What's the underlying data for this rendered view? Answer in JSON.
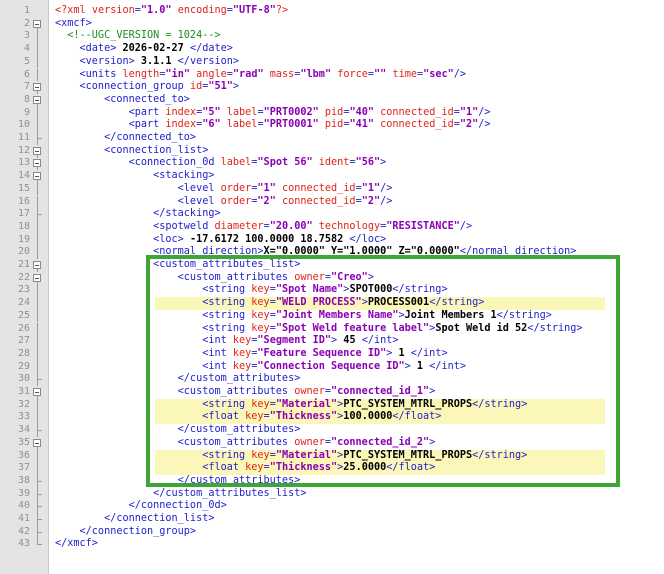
{
  "editor": {
    "accent_color": "#3fa535",
    "highlight_color": "#fbf7b8",
    "lines": [
      {
        "n": "1",
        "seg": [
          {
            "c": "pi",
            "t": "<?xml "
          },
          {
            "c": "attr",
            "t": "version"
          },
          {
            "c": "tag",
            "t": "="
          },
          {
            "c": "val",
            "t": "\"1.0\""
          },
          {
            "c": "attr",
            "t": " encoding"
          },
          {
            "c": "tag",
            "t": "="
          },
          {
            "c": "val",
            "t": "\"UTF-8\""
          },
          {
            "c": "pi",
            "t": "?>"
          }
        ]
      },
      {
        "n": "2",
        "seg": [
          {
            "c": "tag",
            "t": "<xmcf>"
          }
        ]
      },
      {
        "n": "3",
        "seg": [
          {
            "c": "com",
            "t": "  <!--UGC_VERSION = 1024-->"
          }
        ]
      },
      {
        "n": "4",
        "seg": [
          {
            "c": "tag",
            "t": "    <date>"
          },
          {
            "c": "txt",
            "t": " 2026-02-27 "
          },
          {
            "c": "tag",
            "t": "</date>"
          }
        ]
      },
      {
        "n": "5",
        "seg": [
          {
            "c": "tag",
            "t": "    <version>"
          },
          {
            "c": "txt",
            "t": " 3.1.1 "
          },
          {
            "c": "tag",
            "t": "</version>"
          }
        ]
      },
      {
        "n": "6",
        "seg": [
          {
            "c": "tag",
            "t": "    <units "
          },
          {
            "c": "attr",
            "t": "length"
          },
          {
            "c": "tag",
            "t": "="
          },
          {
            "c": "val",
            "t": "\"in\""
          },
          {
            "c": "attr",
            "t": " angle"
          },
          {
            "c": "tag",
            "t": "="
          },
          {
            "c": "val",
            "t": "\"rad\""
          },
          {
            "c": "attr",
            "t": " mass"
          },
          {
            "c": "tag",
            "t": "="
          },
          {
            "c": "val",
            "t": "\"lbm\""
          },
          {
            "c": "attr",
            "t": " force"
          },
          {
            "c": "tag",
            "t": "="
          },
          {
            "c": "val",
            "t": "\"\""
          },
          {
            "c": "attr",
            "t": " time"
          },
          {
            "c": "tag",
            "t": "="
          },
          {
            "c": "val",
            "t": "\"sec\""
          },
          {
            "c": "tag",
            "t": "/>"
          }
        ]
      },
      {
        "n": "7",
        "seg": [
          {
            "c": "tag",
            "t": "    <connection_group "
          },
          {
            "c": "attr",
            "t": "id"
          },
          {
            "c": "tag",
            "t": "="
          },
          {
            "c": "val",
            "t": "\"51\""
          },
          {
            "c": "tag",
            "t": ">"
          }
        ]
      },
      {
        "n": "8",
        "seg": [
          {
            "c": "tag",
            "t": "        <connected_to>"
          }
        ]
      },
      {
        "n": "9",
        "seg": [
          {
            "c": "tag",
            "t": "            <part "
          },
          {
            "c": "attr",
            "t": "index"
          },
          {
            "c": "tag",
            "t": "="
          },
          {
            "c": "val",
            "t": "\"5\""
          },
          {
            "c": "attr",
            "t": " label"
          },
          {
            "c": "tag",
            "t": "="
          },
          {
            "c": "val",
            "t": "\"PRT0002\""
          },
          {
            "c": "attr",
            "t": " pid"
          },
          {
            "c": "tag",
            "t": "="
          },
          {
            "c": "val",
            "t": "\"40\""
          },
          {
            "c": "attr",
            "t": " connected_id"
          },
          {
            "c": "tag",
            "t": "="
          },
          {
            "c": "val",
            "t": "\"1\""
          },
          {
            "c": "tag",
            "t": "/>"
          }
        ]
      },
      {
        "n": "10",
        "seg": [
          {
            "c": "tag",
            "t": "            <part "
          },
          {
            "c": "attr",
            "t": "index"
          },
          {
            "c": "tag",
            "t": "="
          },
          {
            "c": "val",
            "t": "\"6\""
          },
          {
            "c": "attr",
            "t": " label"
          },
          {
            "c": "tag",
            "t": "="
          },
          {
            "c": "val",
            "t": "\"PRT0001\""
          },
          {
            "c": "attr",
            "t": " pid"
          },
          {
            "c": "tag",
            "t": "="
          },
          {
            "c": "val",
            "t": "\"41\""
          },
          {
            "c": "attr",
            "t": " connected_id"
          },
          {
            "c": "tag",
            "t": "="
          },
          {
            "c": "val",
            "t": "\"2\""
          },
          {
            "c": "tag",
            "t": "/>"
          }
        ]
      },
      {
        "n": "11",
        "seg": [
          {
            "c": "tag",
            "t": "        </connected_to>"
          }
        ]
      },
      {
        "n": "12",
        "seg": [
          {
            "c": "tag",
            "t": "        <connection_list>"
          }
        ]
      },
      {
        "n": "13",
        "seg": [
          {
            "c": "tag",
            "t": "            <connection_0d "
          },
          {
            "c": "attr",
            "t": "label"
          },
          {
            "c": "tag",
            "t": "="
          },
          {
            "c": "val",
            "t": "\"Spot 56\""
          },
          {
            "c": "attr",
            "t": " ident"
          },
          {
            "c": "tag",
            "t": "="
          },
          {
            "c": "val",
            "t": "\"56\""
          },
          {
            "c": "tag",
            "t": ">"
          }
        ]
      },
      {
        "n": "14",
        "seg": [
          {
            "c": "tag",
            "t": "                <stacking>"
          }
        ]
      },
      {
        "n": "15",
        "seg": [
          {
            "c": "tag",
            "t": "                    <level "
          },
          {
            "c": "attr",
            "t": "order"
          },
          {
            "c": "tag",
            "t": "="
          },
          {
            "c": "val",
            "t": "\"1\""
          },
          {
            "c": "attr",
            "t": " connected_id"
          },
          {
            "c": "tag",
            "t": "="
          },
          {
            "c": "val",
            "t": "\"1\""
          },
          {
            "c": "tag",
            "t": "/>"
          }
        ]
      },
      {
        "n": "16",
        "seg": [
          {
            "c": "tag",
            "t": "                    <level "
          },
          {
            "c": "attr",
            "t": "order"
          },
          {
            "c": "tag",
            "t": "="
          },
          {
            "c": "val",
            "t": "\"2\""
          },
          {
            "c": "attr",
            "t": " connected_id"
          },
          {
            "c": "tag",
            "t": "="
          },
          {
            "c": "val",
            "t": "\"2\""
          },
          {
            "c": "tag",
            "t": "/>"
          }
        ]
      },
      {
        "n": "17",
        "seg": [
          {
            "c": "tag",
            "t": "                </stacking>"
          }
        ]
      },
      {
        "n": "18",
        "seg": [
          {
            "c": "tag",
            "t": "                <spotweld "
          },
          {
            "c": "attr",
            "t": "diameter"
          },
          {
            "c": "tag",
            "t": "="
          },
          {
            "c": "val",
            "t": "\"20.00\""
          },
          {
            "c": "attr",
            "t": " technology"
          },
          {
            "c": "tag",
            "t": "="
          },
          {
            "c": "val",
            "t": "\"RESISTANCE\""
          },
          {
            "c": "tag",
            "t": "/>"
          }
        ]
      },
      {
        "n": "19",
        "seg": [
          {
            "c": "tag",
            "t": "                <loc>"
          },
          {
            "c": "txt",
            "t": " -17.6172 100.0000 18.7582 "
          },
          {
            "c": "tag",
            "t": "</loc>"
          }
        ]
      },
      {
        "n": "20",
        "seg": [
          {
            "c": "tag",
            "t": "                <normal_direction>"
          },
          {
            "c": "txt",
            "t": "X=\"0.0000\" Y=\"1.0000\" Z=\"0.0000\""
          },
          {
            "c": "tag",
            "t": "</normal_direction>"
          }
        ]
      },
      {
        "n": "21",
        "seg": [
          {
            "c": "tag",
            "t": "                <custom_attributes_list>"
          }
        ]
      },
      {
        "n": "22",
        "seg": [
          {
            "c": "tag",
            "t": "                    <custom_attributes "
          },
          {
            "c": "attr",
            "t": "owner"
          },
          {
            "c": "tag",
            "t": "="
          },
          {
            "c": "val",
            "t": "\"Creo\""
          },
          {
            "c": "tag",
            "t": ">"
          }
        ]
      },
      {
        "n": "23",
        "seg": [
          {
            "c": "tag",
            "t": "                        <string "
          },
          {
            "c": "attr",
            "t": "key"
          },
          {
            "c": "tag",
            "t": "="
          },
          {
            "c": "val",
            "t": "\"Spot Name\""
          },
          {
            "c": "tag",
            "t": ">"
          },
          {
            "c": "txt",
            "t": "SPOT000"
          },
          {
            "c": "tag",
            "t": "</string>"
          }
        ]
      },
      {
        "n": "24",
        "hl": true,
        "seg": [
          {
            "c": "tag",
            "t": "                        <string "
          },
          {
            "c": "attr",
            "t": "key"
          },
          {
            "c": "tag",
            "t": "="
          },
          {
            "c": "val",
            "t": "\"WELD PROCESS\""
          },
          {
            "c": "tag",
            "t": ">"
          },
          {
            "c": "txt",
            "t": "PROCESS001"
          },
          {
            "c": "tag",
            "t": "</string>"
          }
        ]
      },
      {
        "n": "25",
        "seg": [
          {
            "c": "tag",
            "t": "                        <string "
          },
          {
            "c": "attr",
            "t": "key"
          },
          {
            "c": "tag",
            "t": "="
          },
          {
            "c": "val",
            "t": "\"Joint Members Name\""
          },
          {
            "c": "tag",
            "t": ">"
          },
          {
            "c": "txt",
            "t": "Joint Members 1"
          },
          {
            "c": "tag",
            "t": "</string>"
          }
        ]
      },
      {
        "n": "26",
        "seg": [
          {
            "c": "tag",
            "t": "                        <string "
          },
          {
            "c": "attr",
            "t": "key"
          },
          {
            "c": "tag",
            "t": "="
          },
          {
            "c": "val",
            "t": "\"Spot Weld feature label\""
          },
          {
            "c": "tag",
            "t": ">"
          },
          {
            "c": "txt",
            "t": "Spot Weld id 52"
          },
          {
            "c": "tag",
            "t": "</string>"
          }
        ]
      },
      {
        "n": "27",
        "seg": [
          {
            "c": "tag",
            "t": "                        <int "
          },
          {
            "c": "attr",
            "t": "key"
          },
          {
            "c": "tag",
            "t": "="
          },
          {
            "c": "val",
            "t": "\"Segment ID\""
          },
          {
            "c": "tag",
            "t": ">"
          },
          {
            "c": "txt",
            "t": " 45 "
          },
          {
            "c": "tag",
            "t": "</int>"
          }
        ]
      },
      {
        "n": "28",
        "seg": [
          {
            "c": "tag",
            "t": "                        <int "
          },
          {
            "c": "attr",
            "t": "key"
          },
          {
            "c": "tag",
            "t": "="
          },
          {
            "c": "val",
            "t": "\"Feature Sequence ID\""
          },
          {
            "c": "tag",
            "t": ">"
          },
          {
            "c": "txt",
            "t": " 1 "
          },
          {
            "c": "tag",
            "t": "</int>"
          }
        ]
      },
      {
        "n": "29",
        "seg": [
          {
            "c": "tag",
            "t": "                        <int "
          },
          {
            "c": "attr",
            "t": "key"
          },
          {
            "c": "tag",
            "t": "="
          },
          {
            "c": "val",
            "t": "\"Connection Sequence ID\""
          },
          {
            "c": "tag",
            "t": ">"
          },
          {
            "c": "txt",
            "t": " 1 "
          },
          {
            "c": "tag",
            "t": "</int>"
          }
        ]
      },
      {
        "n": "30",
        "seg": [
          {
            "c": "tag",
            "t": "                    </custom_attributes>"
          }
        ]
      },
      {
        "n": "31",
        "seg": [
          {
            "c": "tag",
            "t": "                    <custom_attributes "
          },
          {
            "c": "attr",
            "t": "owner"
          },
          {
            "c": "tag",
            "t": "="
          },
          {
            "c": "val",
            "t": "\"connected_id_1\""
          },
          {
            "c": "tag",
            "t": ">"
          }
        ]
      },
      {
        "n": "32",
        "hl": true,
        "seg": [
          {
            "c": "tag",
            "t": "                        <string "
          },
          {
            "c": "attr",
            "t": "key"
          },
          {
            "c": "tag",
            "t": "="
          },
          {
            "c": "val",
            "t": "\"Material\""
          },
          {
            "c": "tag",
            "t": ">"
          },
          {
            "c": "txt",
            "t": "PTC_SYSTEM_MTRL_PROPS"
          },
          {
            "c": "tag",
            "t": "</string>"
          }
        ]
      },
      {
        "n": "33",
        "hl": true,
        "seg": [
          {
            "c": "tag",
            "t": "                        <float "
          },
          {
            "c": "attr",
            "t": "key"
          },
          {
            "c": "tag",
            "t": "="
          },
          {
            "c": "val",
            "t": "\"Thickness\""
          },
          {
            "c": "tag",
            "t": ">"
          },
          {
            "c": "txt",
            "t": "100.0000"
          },
          {
            "c": "tag",
            "t": "</float>"
          }
        ]
      },
      {
        "n": "34",
        "seg": [
          {
            "c": "tag",
            "t": "                    </custom_attributes>"
          }
        ]
      },
      {
        "n": "35",
        "seg": [
          {
            "c": "tag",
            "t": "                    <custom_attributes "
          },
          {
            "c": "attr",
            "t": "owner"
          },
          {
            "c": "tag",
            "t": "="
          },
          {
            "c": "val",
            "t": "\"connected_id_2\""
          },
          {
            "c": "tag",
            "t": ">"
          }
        ]
      },
      {
        "n": "36",
        "hl": true,
        "seg": [
          {
            "c": "tag",
            "t": "                        <string "
          },
          {
            "c": "attr",
            "t": "key"
          },
          {
            "c": "tag",
            "t": "="
          },
          {
            "c": "val",
            "t": "\"Material\""
          },
          {
            "c": "tag",
            "t": ">"
          },
          {
            "c": "txt",
            "t": "PTC_SYSTEM_MTRL_PROPS"
          },
          {
            "c": "tag",
            "t": "</string>"
          }
        ]
      },
      {
        "n": "37",
        "hl": true,
        "seg": [
          {
            "c": "tag",
            "t": "                        <float "
          },
          {
            "c": "attr",
            "t": "key"
          },
          {
            "c": "tag",
            "t": "="
          },
          {
            "c": "val",
            "t": "\"Thickness\""
          },
          {
            "c": "tag",
            "t": ">"
          },
          {
            "c": "txt",
            "t": "25.0000"
          },
          {
            "c": "tag",
            "t": "</float>"
          }
        ]
      },
      {
        "n": "38",
        "seg": [
          {
            "c": "tag",
            "t": "                    </custom_attributes>"
          }
        ]
      },
      {
        "n": "39",
        "seg": [
          {
            "c": "tag",
            "t": "                </custom_attributes_list>"
          }
        ]
      },
      {
        "n": "40",
        "seg": [
          {
            "c": "tag",
            "t": "            </connection_0d>"
          }
        ]
      },
      {
        "n": "41",
        "seg": [
          {
            "c": "tag",
            "t": "        </connection_list>"
          }
        ]
      },
      {
        "n": "42",
        "seg": [
          {
            "c": "tag",
            "t": "    </connection_group>"
          }
        ]
      },
      {
        "n": "43",
        "seg": [
          {
            "c": "tag",
            "t": "</xmcf>"
          }
        ]
      }
    ]
  }
}
